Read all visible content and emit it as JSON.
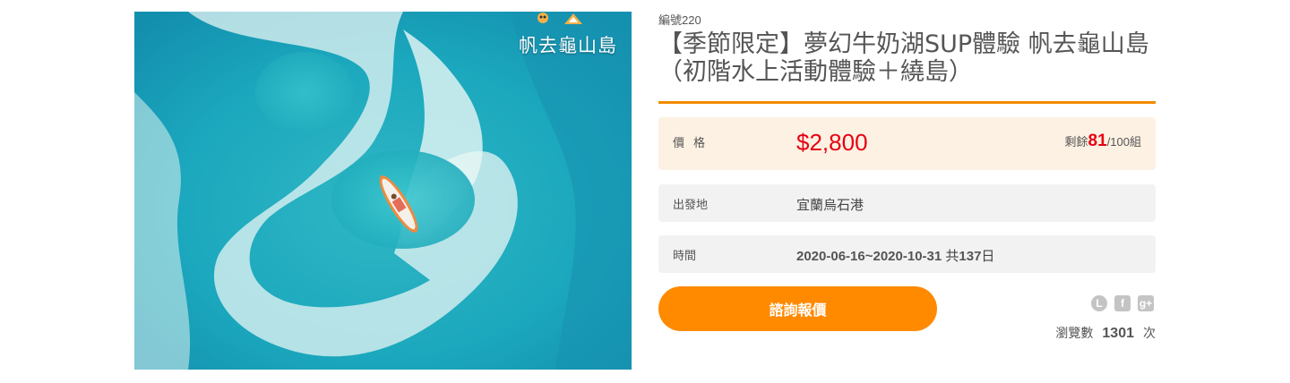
{
  "photo": {
    "caption": "帆去龜山島",
    "alt_subject": "aerial-sup-board-icon"
  },
  "product": {
    "code": "編號220",
    "title": "【季節限定】夢幻牛奶湖SUP體驗 帆去龜山島（初階水上活動體驗＋繞島）"
  },
  "price": {
    "label": "價格",
    "amount": "$2,800",
    "stock_prefix": "剩餘",
    "stock_remaining": "81",
    "stock_suffix": "/100組"
  },
  "origin": {
    "label": "出發地",
    "value": "宜蘭烏石港"
  },
  "time": {
    "label": "時間",
    "date_range": "2020-06-16~2020-10-31",
    "total_prefix": " 共",
    "total_days": "137",
    "total_suffix": "日"
  },
  "actions": {
    "inquire_label": "諮詢報價"
  },
  "share": {
    "icons": [
      "line-icon",
      "facebook-icon",
      "google-plus-icon"
    ],
    "line_glyph": "L",
    "facebook_glyph": "f",
    "google_glyph": "g+"
  },
  "stats": {
    "views_label": "瀏覽數",
    "views_count": "1301",
    "views_unit": "次"
  },
  "colors": {
    "accent": "#ff8a00",
    "price": "#e60012",
    "price_bg": "#fdf1e3",
    "row_bg": "#f2f2f2"
  }
}
